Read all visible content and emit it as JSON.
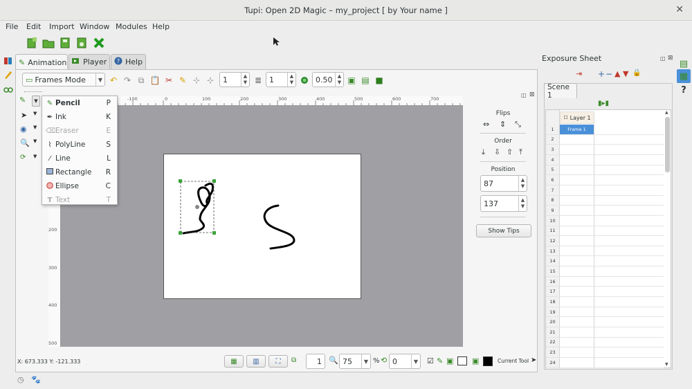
{
  "window": {
    "title": "Tupi: Open 2D Magic – my_project [ by Your name ]",
    "close_glyph": "✕"
  },
  "menubar": [
    "File",
    "Edit",
    "Import",
    "Window",
    "Modules",
    "Help"
  ],
  "tabs": [
    {
      "label": "Animation",
      "icon": "animation-icon"
    },
    {
      "label": "Player",
      "icon": "player-icon"
    },
    {
      "label": "Help",
      "icon": "help-icon"
    }
  ],
  "workspace_toolbar": {
    "mode": "Frames Mode",
    "spin1": "1",
    "spin2": "1",
    "opacity": "0.50"
  },
  "ruler_h": [
    "-100",
    "0",
    "100",
    "200",
    "300",
    "400",
    "500",
    "600",
    "700"
  ],
  "ruler_v": [
    "200",
    "300",
    "400",
    "500"
  ],
  "tool_menu": [
    {
      "label": "Pencil",
      "key": "P",
      "icon": "pencil-icon",
      "enabled": true,
      "bold": true
    },
    {
      "label": "Ink",
      "key": "K",
      "icon": "ink-icon",
      "enabled": true,
      "bold": false
    },
    {
      "label": "Eraser",
      "key": "E",
      "icon": "eraser-icon",
      "enabled": false,
      "bold": false
    },
    {
      "label": "PolyLine",
      "key": "S",
      "icon": "polyline-icon",
      "enabled": true,
      "bold": false
    },
    {
      "label": "Line",
      "key": "L",
      "icon": "line-icon",
      "enabled": true,
      "bold": false
    },
    {
      "label": "Rectangle",
      "key": "R",
      "icon": "rectangle-icon",
      "enabled": true,
      "bold": false
    },
    {
      "label": "Ellipse",
      "key": "C",
      "icon": "ellipse-icon",
      "enabled": true,
      "bold": false
    },
    {
      "label": "Text",
      "key": "T",
      "icon": "text-icon",
      "enabled": false,
      "bold": false
    }
  ],
  "side_panel": {
    "flips_label": "Flips",
    "order_label": "Order",
    "position_label": "Position",
    "pos_x": "87",
    "pos_y": "137",
    "show_tips": "Show Tips"
  },
  "bottom_bar": {
    "frame": "1",
    "zoom": "75",
    "zoom_unit": "%",
    "rotation": "0",
    "current_tool_label": "Current Tool"
  },
  "status": {
    "coords": "X: 673.333 Y: -121.333"
  },
  "exposure": {
    "title": "Exposure Sheet",
    "scene_tab": "Scene 1",
    "layer": "Layer 1",
    "frame1": "Frame 1",
    "rows": [
      "1",
      "2",
      "3",
      "4",
      "5",
      "6",
      "7",
      "8",
      "9",
      "10",
      "11",
      "12",
      "13",
      "14",
      "15",
      "16",
      "17",
      "18",
      "19",
      "20",
      "21",
      "22",
      "23",
      "24"
    ]
  }
}
